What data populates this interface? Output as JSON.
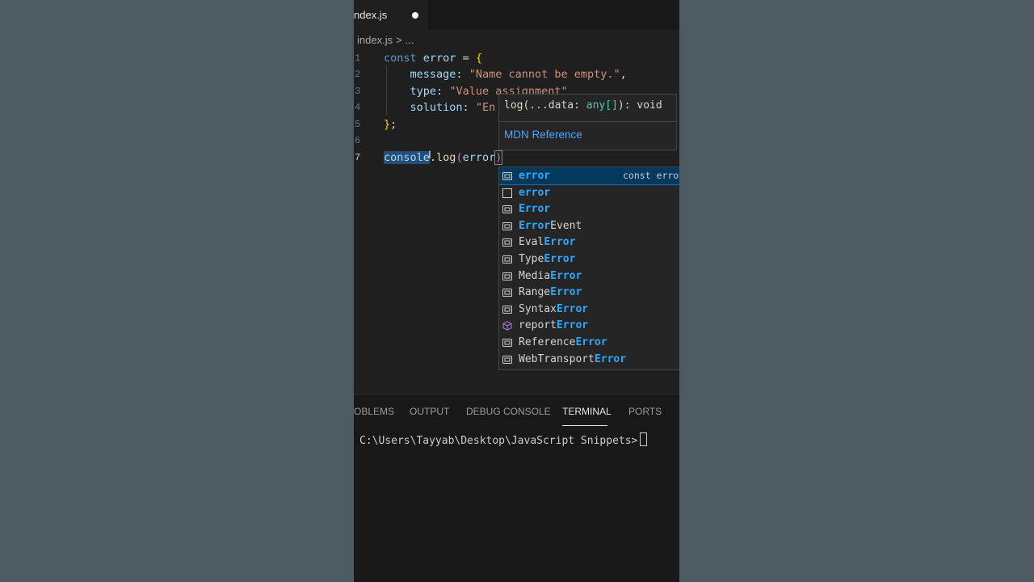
{
  "tab": {
    "filename": "ndex.js"
  },
  "breadcrumb": {
    "file": "index.js",
    "separator": ">",
    "ellipsis": "..."
  },
  "editor": {
    "line_numbers": [
      "1",
      "2",
      "3",
      "4",
      "5",
      "6",
      "7"
    ],
    "lines": [
      {
        "t1": "const",
        "t2": "error",
        "t3": "=",
        "t4": "{"
      },
      {
        "prop": "message",
        "colon": ":",
        "value": "\"Name cannot be empty.\"",
        "comma": ","
      },
      {
        "prop": "type",
        "colon": ":",
        "value": "\"Value assignment\""
      },
      {
        "prop": "solution",
        "colon": ":",
        "value": "\"En"
      },
      {
        "close": "}",
        "semi": ";"
      },
      {},
      {
        "obj": "console",
        "dot": ".",
        "method": "log",
        "open": "(",
        "arg": "error",
        "close": ")"
      }
    ]
  },
  "hover": {
    "fn": "log",
    "params": "(...data: ",
    "type": "any[]",
    "ret": "): void",
    "link": "MDN Reference"
  },
  "suggestions": [
    {
      "pre": "",
      "hl": "error",
      "post": "",
      "icon": "variable-icon",
      "detail": "const erro"
    },
    {
      "pre": "",
      "hl": "error",
      "post": "",
      "icon": "text-icon",
      "detail": ""
    },
    {
      "pre": "",
      "hl": "Error",
      "post": "",
      "icon": "variable-icon",
      "detail": ""
    },
    {
      "pre": "",
      "hl": "Error",
      "post": "Event",
      "icon": "variable-icon",
      "detail": ""
    },
    {
      "pre": "Eval",
      "hl": "Error",
      "post": "",
      "icon": "variable-icon",
      "detail": ""
    },
    {
      "pre": "Type",
      "hl": "Error",
      "post": "",
      "icon": "variable-icon",
      "detail": ""
    },
    {
      "pre": "Media",
      "hl": "Error",
      "post": "",
      "icon": "variable-icon",
      "detail": ""
    },
    {
      "pre": "Range",
      "hl": "Error",
      "post": "",
      "icon": "variable-icon",
      "detail": ""
    },
    {
      "pre": "Syntax",
      "hl": "Error",
      "post": "",
      "icon": "variable-icon",
      "detail": ""
    },
    {
      "pre": "report",
      "hl": "Error",
      "post": "",
      "icon": "method-icon",
      "detail": ""
    },
    {
      "pre": "Reference",
      "hl": "Error",
      "post": "",
      "icon": "variable-icon",
      "detail": ""
    },
    {
      "pre": "WebTransport",
      "hl": "Error",
      "post": "",
      "icon": "variable-icon",
      "detail": ""
    }
  ],
  "panel": {
    "tabs": [
      "OBLEMS",
      "OUTPUT",
      "DEBUG CONSOLE",
      "TERMINAL",
      "PORTS"
    ],
    "active_tab": "TERMINAL",
    "prompt": "C:\\Users\\Tayyab\\Desktop\\JavaScript Snippets>"
  },
  "colors": {
    "accent_link": "#4da6ff",
    "suggest_highlight": "#2aaaff",
    "selected_row": "#04395e"
  }
}
